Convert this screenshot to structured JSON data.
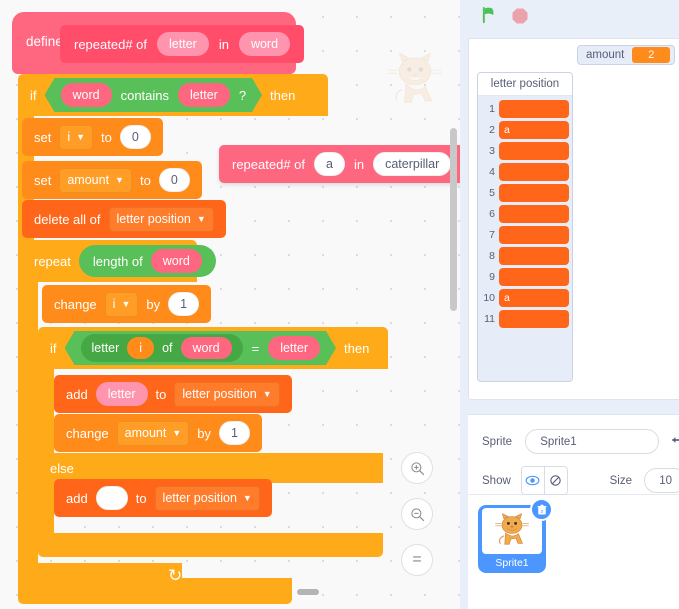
{
  "scripts": {
    "define_hat": {
      "define_label": "define",
      "proc_parts": [
        "repeated# of",
        "in"
      ],
      "param_letter": "letter",
      "param_word": "word"
    },
    "if_contains": {
      "if_label": "if",
      "then_label": "then",
      "operand_word": "word",
      "contains_label": "contains",
      "operand_letter": "letter",
      "question_mark": "?"
    },
    "set_i": {
      "set_label": "set",
      "variable": "i",
      "to_label": "to",
      "value": "0"
    },
    "set_amount": {
      "set_label": "set",
      "variable": "amount",
      "to_label": "to",
      "value": "0"
    },
    "delete_all": {
      "label": "delete all of",
      "list": "letter position"
    },
    "repeat_block": {
      "repeat_label": "repeat",
      "length_of_label": "length of",
      "operand": "word"
    },
    "change_i": {
      "change_label": "change",
      "variable": "i",
      "by_label": "by",
      "value": "1"
    },
    "if_equals": {
      "if_label": "if",
      "then_label": "then",
      "letter_label": "letter",
      "index": "i",
      "of_label": "of",
      "word": "word",
      "equals": "=",
      "compare_letter": "letter"
    },
    "add_letter": {
      "add_label": "add",
      "value": "letter",
      "to_label": "to",
      "list": "letter position"
    },
    "change_amount": {
      "change_label": "change",
      "variable": "amount",
      "by_label": "by",
      "value": "1"
    },
    "else_label": "else",
    "add_empty": {
      "add_label": "add",
      "value": "",
      "to_label": "to",
      "list": "letter position"
    }
  },
  "floating_block": {
    "prefix": "repeated# of",
    "arg_letter": "a",
    "middle": "in",
    "arg_word": "caterpillar"
  },
  "zoom_controls": {
    "zoom_in": "zoom-in",
    "zoom_out": "zoom-out",
    "zoom_reset": "="
  },
  "stage": {
    "green_flag": "green-flag",
    "stop_sign": "stop-sign",
    "amount_monitor": {
      "name": "amount",
      "value": "2"
    },
    "list_monitor": {
      "title": "letter position",
      "rows": [
        {
          "index": "1",
          "value": ""
        },
        {
          "index": "2",
          "value": "a"
        },
        {
          "index": "3",
          "value": ""
        },
        {
          "index": "4",
          "value": ""
        },
        {
          "index": "5",
          "value": ""
        },
        {
          "index": "6",
          "value": ""
        },
        {
          "index": "7",
          "value": ""
        },
        {
          "index": "8",
          "value": ""
        },
        {
          "index": "9",
          "value": ""
        },
        {
          "index": "10",
          "value": "a"
        },
        {
          "index": "11",
          "value": ""
        }
      ]
    }
  },
  "sprite_panel": {
    "sprite_label": "Sprite",
    "sprite_name": "Sprite1",
    "show_label": "Show",
    "size_label": "Size",
    "size_value": "10",
    "thumb_name": "Sprite1"
  },
  "colors": {
    "variables_orange": "#ff8c1a",
    "list_orange": "#ff661a",
    "control_yellow": "#ffab19",
    "operators_green": "#59c059",
    "custom_pink": "#ff6680",
    "accent_blue": "#4c97ff"
  }
}
